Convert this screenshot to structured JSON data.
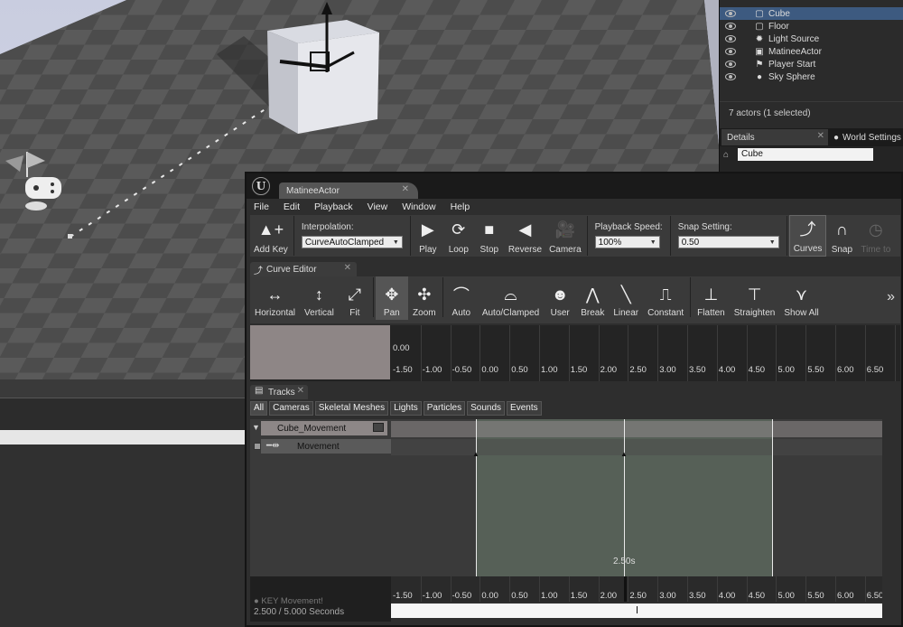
{
  "outliner": {
    "actors": [
      {
        "name": "Cube",
        "icon": "cube-icon",
        "glyph": "▢"
      },
      {
        "name": "Floor",
        "icon": "cube-icon",
        "glyph": "▢"
      },
      {
        "name": "Light Source",
        "icon": "light-icon",
        "glyph": "✹"
      },
      {
        "name": "MatineeActor",
        "icon": "matinee-icon",
        "glyph": "▣"
      },
      {
        "name": "Player Start",
        "icon": "flag-icon",
        "glyph": "⚑"
      },
      {
        "name": "Sky Sphere",
        "icon": "sphere-icon",
        "glyph": "●"
      }
    ],
    "footer": "7 actors (1 selected)"
  },
  "details": {
    "tab_details": "Details",
    "tab_world": "World Settings",
    "name_value": "Cube"
  },
  "matinee": {
    "doc_tab": "MatineeActor",
    "logo_letter": "U",
    "menu": [
      "File",
      "Edit",
      "Playback",
      "View",
      "Window",
      "Help"
    ],
    "toolbar": {
      "add_key": "Add Key",
      "interpolation_label": "Interpolation:",
      "interpolation_value": "CurveAutoClamped",
      "play": "Play",
      "loop": "Loop",
      "stop": "Stop",
      "reverse": "Reverse",
      "camera": "Camera",
      "playback_speed_label": "Playback Speed:",
      "playback_speed_value": "100%",
      "snap_setting_label": "Snap Setting:",
      "snap_setting_value": "0.50",
      "curves": "Curves",
      "snap": "Snap",
      "time_to": "Time to"
    },
    "curve_editor": {
      "tab": "Curve Editor",
      "buttons": [
        "Horizontal",
        "Vertical",
        "Fit",
        "Pan",
        "Zoom",
        "Auto",
        "Auto/Clamped",
        "User",
        "Break",
        "Linear",
        "Constant",
        "Flatten",
        "Straighten",
        "Show All"
      ],
      "y_label": "0.00",
      "ruler": [
        "-1.50",
        "-1.00",
        "-0.50",
        "0.00",
        "0.50",
        "1.00",
        "1.50",
        "2.00",
        "2.50",
        "3.00",
        "3.50",
        "4.00",
        "4.50",
        "5.00",
        "5.50",
        "6.00",
        "6.50"
      ]
    },
    "tracks": {
      "tab": "Tracks",
      "filters": [
        "All",
        "Cameras",
        "Skeletal Meshes",
        "Lights",
        "Particles",
        "Sounds",
        "Events"
      ],
      "group_name": "Cube_Movement",
      "track_name": "Movement",
      "playhead_label": "2.50s",
      "key_label": "KEY Movement!",
      "seconds": "2.500 / 5.000 Seconds",
      "ruler": [
        "-1.50",
        "-1.00",
        "-0.50",
        "0.00",
        "0.50",
        "1.00",
        "1.50",
        "2.00",
        "2.50",
        "3.00",
        "3.50",
        "4.00",
        "4.50",
        "5.00",
        "5.50",
        "6.00",
        "6.50"
      ]
    }
  }
}
